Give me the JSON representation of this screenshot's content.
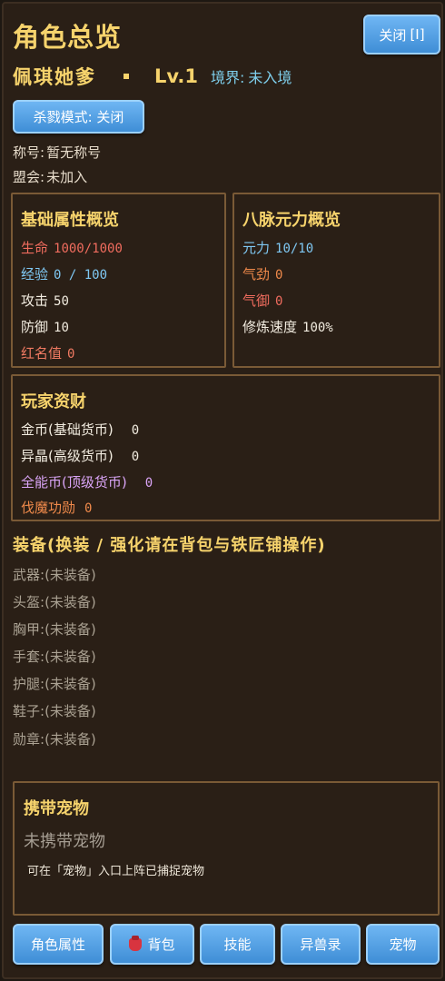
{
  "header": {
    "title": "角色总览",
    "close_label": "关闭",
    "close_hotkey": "[I]"
  },
  "player": {
    "name": "佩琪她爹",
    "separator": "·",
    "level": "Lv.1",
    "realm_label": "境界:",
    "realm_value": "未入境",
    "kill_mode_label": "杀戮模式: 关闭",
    "title_label": "称号:",
    "title_value": "暂无称号",
    "guild_label": "盟会:",
    "guild_value": "未加入"
  },
  "base_stats": {
    "heading": "基础属性概览",
    "items": [
      {
        "label": "生命",
        "value": "1000/1000",
        "color": "#f06c5e"
      },
      {
        "label": "经验",
        "value": "0 / 100",
        "color": "#7fc8f3"
      },
      {
        "label": "攻击",
        "value": "50",
        "color": "#f2ece0"
      },
      {
        "label": "防御",
        "value": "10",
        "color": "#f2ece0"
      },
      {
        "label": "红名值",
        "value": "0",
        "color": "#f07a62"
      }
    ]
  },
  "meridians": {
    "heading": "八脉元力概览",
    "items": [
      {
        "label": "元力",
        "value": "10/10",
        "color": "#7fc8f3"
      },
      {
        "label": "气劲",
        "value": "0",
        "color": "#f08a4b"
      },
      {
        "label": "气御",
        "value": "0",
        "color": "#f06c5e"
      },
      {
        "label": "修炼速度",
        "value": "100%",
        "color": "#f2ece0"
      }
    ]
  },
  "wealth": {
    "heading": "玩家资财",
    "items": [
      {
        "label": "金币(基础货币)",
        "value": "0",
        "color": "#f2ece0"
      },
      {
        "label": "异晶(高级货币)",
        "value": "0",
        "color": "#f2ece0"
      },
      {
        "label": "全能币(顶级货币)",
        "value": "0",
        "color": "#d9a4f6"
      },
      {
        "label": "伐魔功勋",
        "value": "0",
        "color": "#f08a4b"
      }
    ]
  },
  "equipment": {
    "heading": "装备(换装 / 强化请在背包与铁匠铺操作)",
    "slots": [
      {
        "slot": "武器:",
        "value": "(未装备)"
      },
      {
        "slot": "头盔:",
        "value": "(未装备)"
      },
      {
        "slot": "胸甲:",
        "value": "(未装备)"
      },
      {
        "slot": "手套:",
        "value": "(未装备)"
      },
      {
        "slot": "护腿:",
        "value": "(未装备)"
      },
      {
        "slot": "鞋子:",
        "value": "(未装备)"
      },
      {
        "slot": "勋章:",
        "value": "(未装备)"
      }
    ]
  },
  "pet": {
    "heading": "携带宠物",
    "empty_text": "未携带宠物",
    "hint": "可在「宠物」入口上阵已捕捉宠物"
  },
  "nav": {
    "attributes": "角色属性",
    "bag_icon": "backpack-icon",
    "bag": "背包",
    "skills": "技能",
    "bestiary": "异兽录",
    "pets": "宠物"
  }
}
